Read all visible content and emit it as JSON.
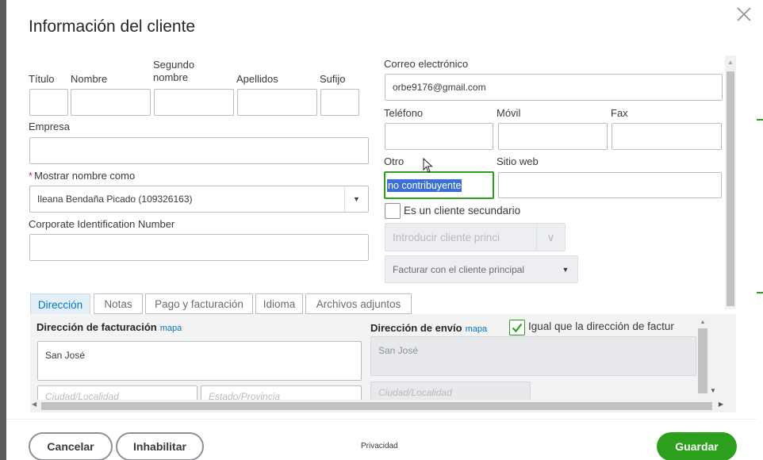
{
  "dialog": {
    "title": "Información del cliente",
    "close_label": "×"
  },
  "name_section": {
    "titulo_label": "Título",
    "nombre_label": "Nombre",
    "segundo_label": "Segundo\nnombre",
    "apellidos_label": "Apellidos",
    "sufijo_label": "Sufijo",
    "empresa_label": "Empresa",
    "mostrar_label": "Mostrar nombre como",
    "mostrar_value": "Ileana Bendaña Picado (109326163)",
    "cin_label": "Corporate Identification Number"
  },
  "contact_section": {
    "correo_label": "Correo electrónico",
    "correo_value": "orbe9176@gmail.com",
    "telefono_label": "Teléfono",
    "movil_label": "Móvil",
    "fax_label": "Fax",
    "otro_label": "Otro",
    "otro_value": "no contribuyente",
    "sitio_label": "Sitio web",
    "secundario_label": "Es un cliente secundario",
    "principal_placeholder": "Introducir cliente princi",
    "facturar_value": "Facturar con el cliente principal"
  },
  "tabs": [
    {
      "label": "Dirección"
    },
    {
      "label": "Notas"
    },
    {
      "label": "Pago y facturación"
    },
    {
      "label": "Idioma"
    },
    {
      "label": "Archivos adjuntos"
    }
  ],
  "address": {
    "billing_label": "Dirección de facturación",
    "billing_map": "mapa",
    "billing_street": "San José",
    "billing_city_placeholder": "Ciudad/Localidad",
    "billing_state_placeholder": "Estado/Provincia",
    "shipping_label": "Dirección de envío",
    "shipping_map": "mapa",
    "same_label": "Igual que la dirección de factur",
    "shipping_street": "San José",
    "shipping_city_placeholder": "Ciudad/Localidad"
  },
  "footer": {
    "cancel": "Cancelar",
    "disable": "Inhabilitar",
    "privacy": "Privacidad",
    "save": "Guardar"
  },
  "colors": {
    "accent": "#2ca01c",
    "link": "#0077c5",
    "selection": "#3c6fd3",
    "required": "#d52b1e"
  }
}
